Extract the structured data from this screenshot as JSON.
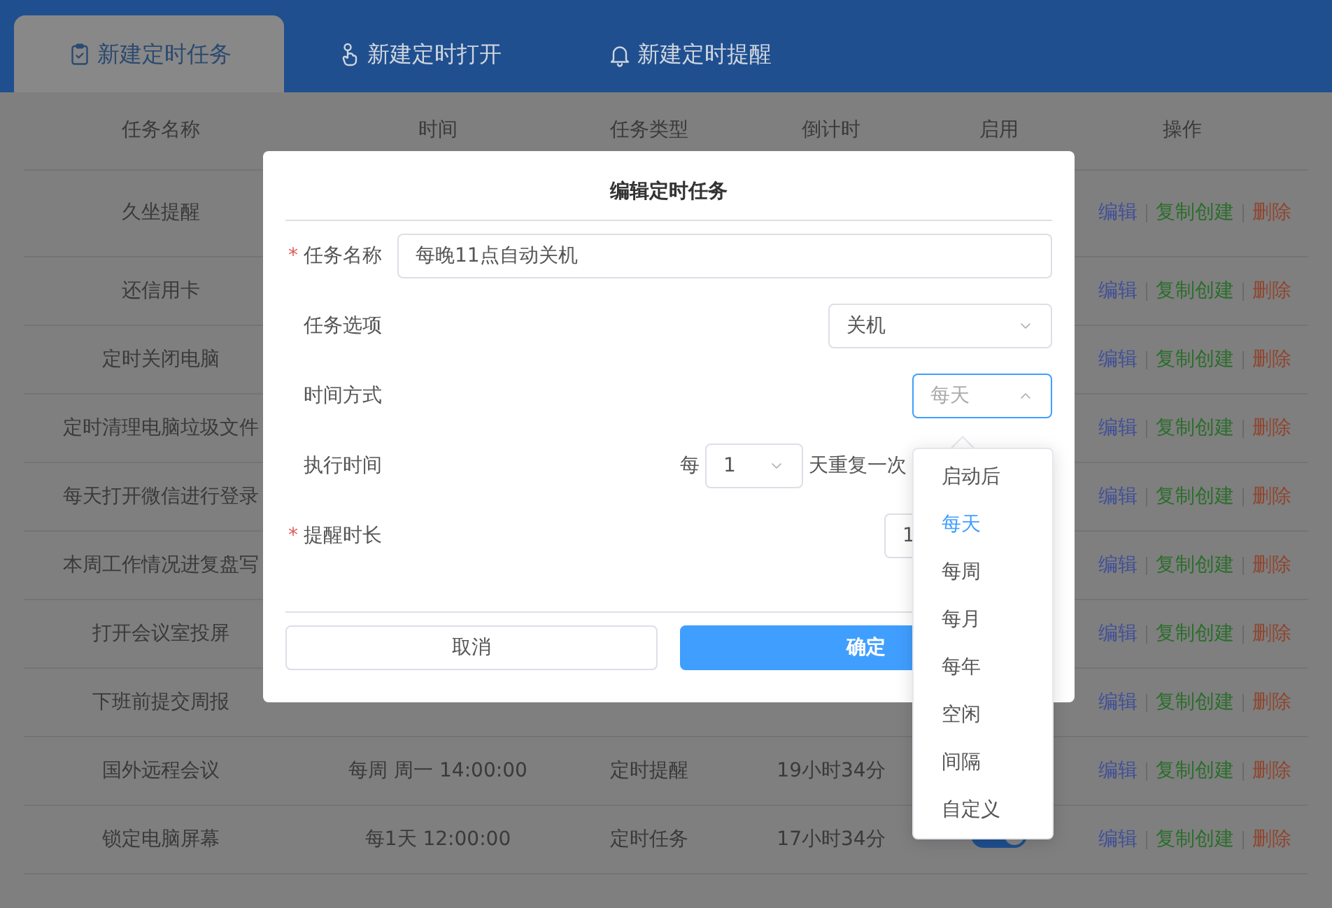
{
  "tabs": [
    {
      "label": "新建定时任务",
      "selected": true
    },
    {
      "label": "新建定时打开",
      "selected": false
    },
    {
      "label": "新建定时提醒",
      "selected": false
    }
  ],
  "table": {
    "columns": [
      "任务名称",
      "时间",
      "任务类型",
      "倒计时",
      "启用",
      "操作"
    ],
    "rows": [
      {
        "name": "久坐提醒",
        "actions": [
          {
            "label": "编辑",
            "kind": "edit"
          },
          {
            "label": "复制创建",
            "kind": "copy"
          },
          {
            "label": "删除",
            "kind": "delete"
          }
        ]
      },
      {
        "name": "还信用卡",
        "actions": [
          {
            "label": "编辑",
            "kind": "edit"
          },
          {
            "label": "复制创建",
            "kind": "copy"
          },
          {
            "label": "删除",
            "kind": "delete"
          }
        ]
      },
      {
        "name": "定时关闭电脑",
        "actions": [
          {
            "label": "编辑",
            "kind": "edit"
          },
          {
            "label": "复制创建",
            "kind": "copy"
          },
          {
            "label": "删除",
            "kind": "delete"
          }
        ]
      },
      {
        "name": "定时清理电脑垃圾文件",
        "actions": [
          {
            "label": "编辑",
            "kind": "edit"
          },
          {
            "label": "复制创建",
            "kind": "copy"
          },
          {
            "label": "删除",
            "kind": "delete"
          }
        ]
      },
      {
        "name": "每天打开微信进行登录",
        "actions": [
          {
            "label": "编辑",
            "kind": "edit"
          },
          {
            "label": "复制创建",
            "kind": "copy"
          },
          {
            "label": "删除",
            "kind": "delete"
          }
        ]
      },
      {
        "name": "本周工作情况进复盘写",
        "actions": [
          {
            "label": "编辑",
            "kind": "edit"
          },
          {
            "label": "复制创建",
            "kind": "copy"
          },
          {
            "label": "删除",
            "kind": "delete"
          }
        ]
      },
      {
        "name": "打开会议室投屏",
        "actions": [
          {
            "label": "编辑",
            "kind": "edit"
          },
          {
            "label": "复制创建",
            "kind": "copy"
          },
          {
            "label": "删除",
            "kind": "delete"
          }
        ]
      },
      {
        "name": "下班前提交周报",
        "actions": [
          {
            "label": "编辑",
            "kind": "edit"
          },
          {
            "label": "复制创建",
            "kind": "copy"
          },
          {
            "label": "删除",
            "kind": "delete"
          }
        ]
      },
      {
        "name": "国外远程会议",
        "time": "每周 周一 14:00:00",
        "type": "定时提醒",
        "countdown": "19小时34分",
        "actions": [
          {
            "label": "编辑",
            "kind": "edit"
          },
          {
            "label": "复制创建",
            "kind": "copy"
          },
          {
            "label": "删除",
            "kind": "delete"
          }
        ]
      },
      {
        "name": "锁定电脑屏幕",
        "time": "每1天 12:00:00",
        "type": "定时任务",
        "countdown": "17小时34分",
        "enabled": true,
        "actions": [
          {
            "label": "编辑",
            "kind": "edit"
          },
          {
            "label": "复制创建",
            "kind": "copy"
          },
          {
            "label": "删除",
            "kind": "delete"
          }
        ]
      }
    ]
  },
  "dialog": {
    "title": "编辑定时任务",
    "fields": [
      {
        "kind": "text",
        "label": "任务名称",
        "required_mark": "*",
        "value": "每晚11点自动关机"
      },
      {
        "kind": "select",
        "label": "任务选项",
        "value": "关机",
        "expanded": false
      },
      {
        "kind": "select",
        "label": "时间方式",
        "placeholder": "每天",
        "expanded": true,
        "options": [
          {
            "label": "启动后",
            "selected": false
          },
          {
            "label": "每天",
            "selected": true
          },
          {
            "label": "每周",
            "selected": false
          },
          {
            "label": "每月",
            "selected": false
          },
          {
            "label": "每年",
            "selected": false
          },
          {
            "label": "空闲",
            "selected": false
          },
          {
            "label": "间隔",
            "selected": false
          },
          {
            "label": "自定义",
            "selected": false
          }
        ]
      },
      {
        "kind": "repeat",
        "label": "执行时间",
        "prefix": "每",
        "value": "1",
        "suffix": "天重复一次"
      },
      {
        "kind": "short",
        "label": "提醒时长",
        "required_mark": "*",
        "value": "1"
      }
    ],
    "buttons": [
      {
        "label": "取消",
        "kind": "secondary"
      },
      {
        "label": "确定",
        "kind": "primary"
      }
    ]
  }
}
